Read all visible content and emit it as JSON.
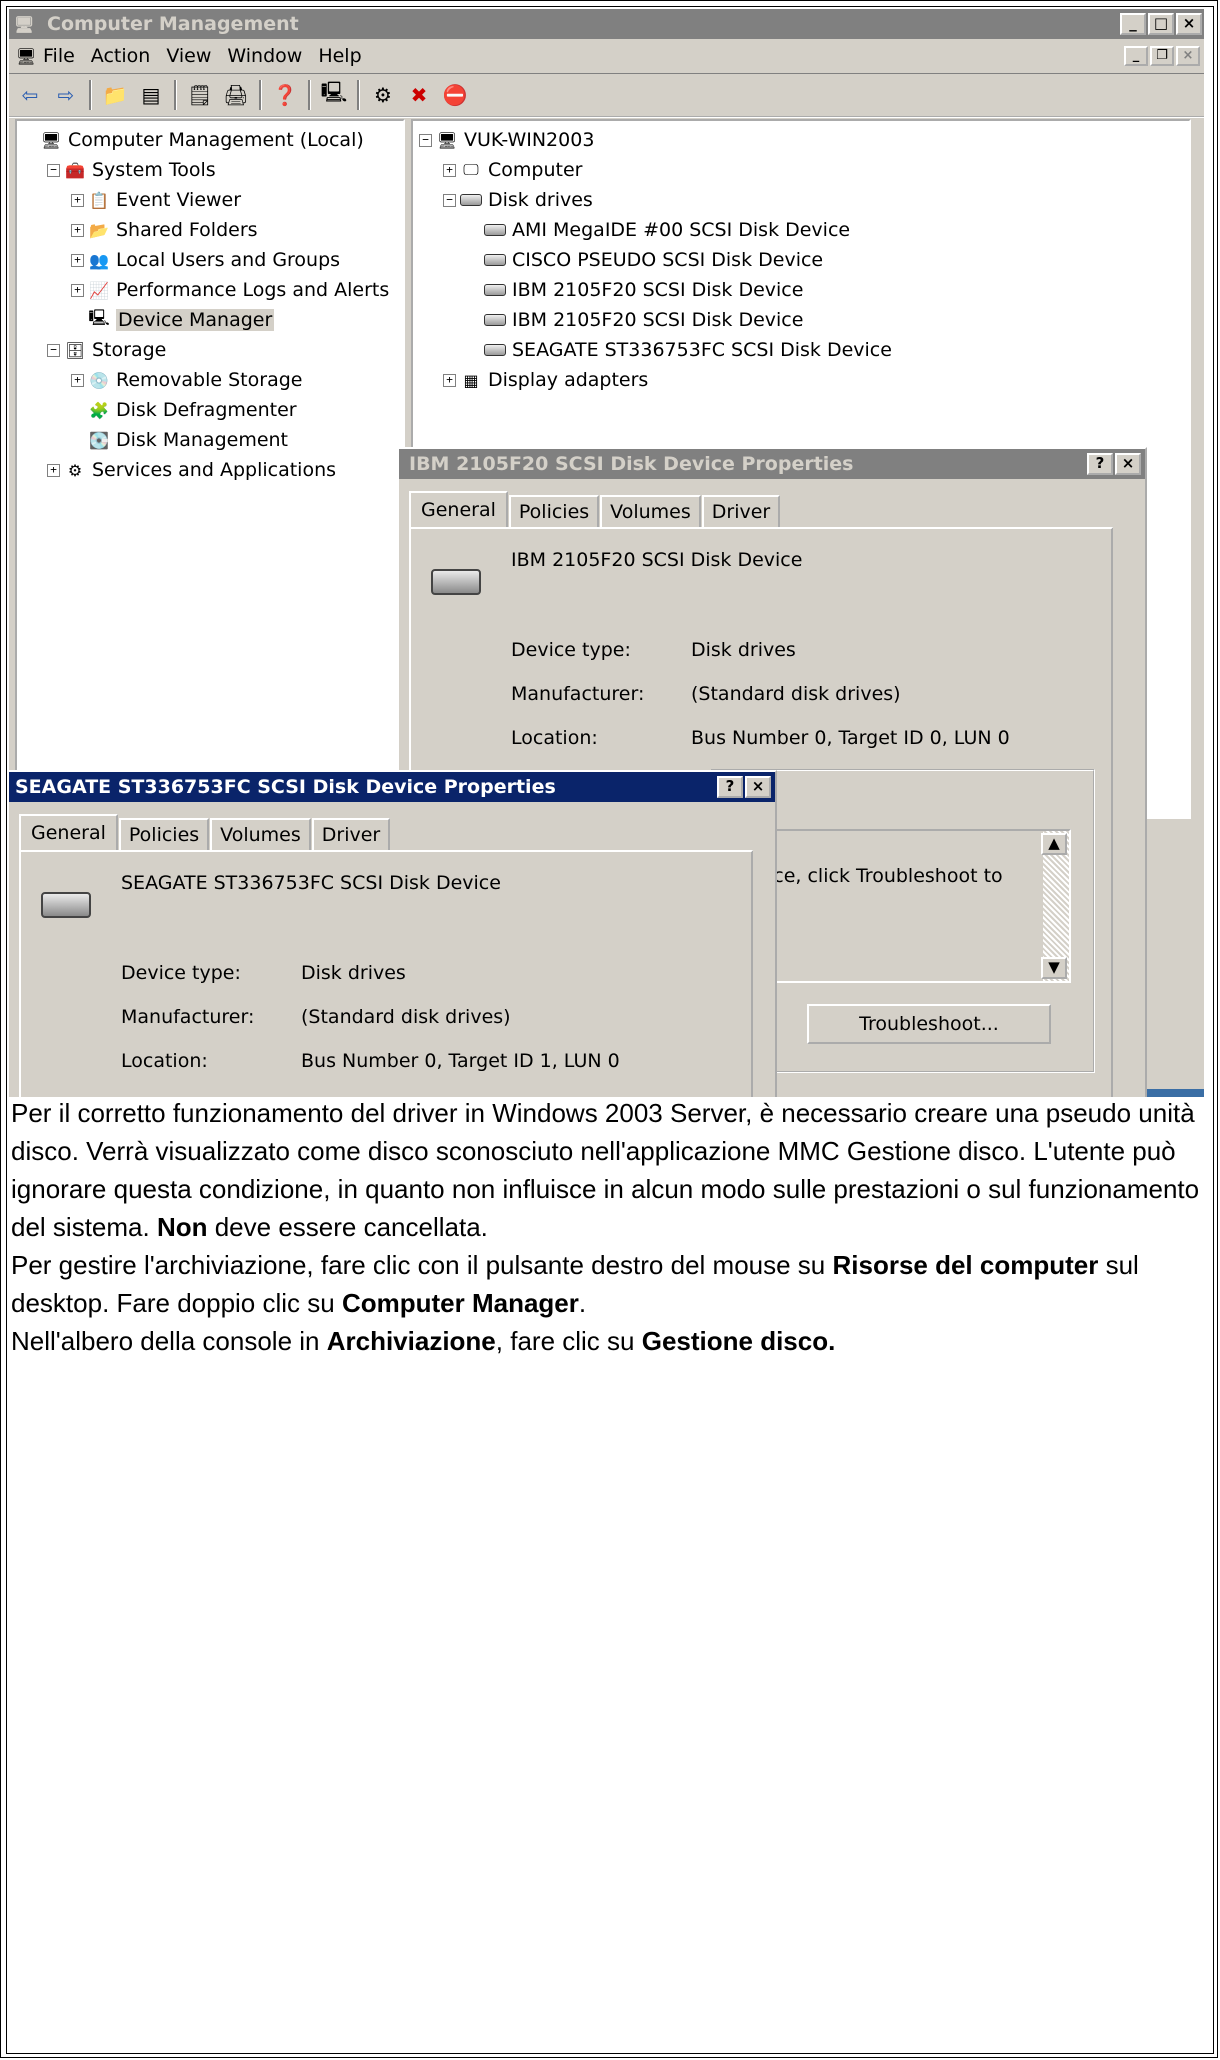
{
  "mmc": {
    "title": "Computer Management",
    "menu": [
      "File",
      "Action",
      "View",
      "Window",
      "Help"
    ],
    "menu_underline": [
      "F",
      "A",
      "V",
      "W",
      "H"
    ],
    "left_tree": [
      {
        "label": "Computer Management (Local)",
        "level": 0,
        "expander": "",
        "icon": "computer-management-icon"
      },
      {
        "label": "System Tools",
        "level": 1,
        "expander": "−",
        "icon": "system-tools-icon"
      },
      {
        "label": "Event Viewer",
        "level": 2,
        "expander": "+",
        "icon": "event-viewer-icon"
      },
      {
        "label": "Shared Folders",
        "level": 2,
        "expander": "+",
        "icon": "shared-folders-icon"
      },
      {
        "label": "Local Users and Groups",
        "level": 2,
        "expander": "+",
        "icon": "users-icon"
      },
      {
        "label": "Performance Logs and Alerts",
        "level": 2,
        "expander": "+",
        "icon": "performance-icon"
      },
      {
        "label": "Device Manager",
        "level": 2,
        "expander": "",
        "icon": "device-manager-icon",
        "selected": true
      },
      {
        "label": "Storage",
        "level": 1,
        "expander": "−",
        "icon": "storage-icon"
      },
      {
        "label": "Removable Storage",
        "level": 2,
        "expander": "+",
        "icon": "removable-storage-icon"
      },
      {
        "label": "Disk Defragmenter",
        "level": 2,
        "expander": "",
        "icon": "defragmenter-icon"
      },
      {
        "label": "Disk Management",
        "level": 2,
        "expander": "",
        "icon": "disk-management-icon"
      },
      {
        "label": "Services and Applications",
        "level": 1,
        "expander": "+",
        "icon": "services-icon"
      }
    ],
    "right_tree": [
      {
        "label": "VUK-WIN2003",
        "level": 0,
        "expander": "−",
        "icon": "computer-icon"
      },
      {
        "label": "Computer",
        "level": 1,
        "expander": "+",
        "icon": "monitor-icon"
      },
      {
        "label": "Disk drives",
        "level": 1,
        "expander": "−",
        "icon": "disk-icon"
      },
      {
        "label": "AMI MegaIDE #00 SCSI Disk Device",
        "level": 2,
        "expander": "",
        "icon": "disk-icon"
      },
      {
        "label": "CISCO PSEUDO SCSI Disk Device",
        "level": 2,
        "expander": "",
        "icon": "disk-icon"
      },
      {
        "label": "IBM 2105F20 SCSI Disk Device",
        "level": 2,
        "expander": "",
        "icon": "disk-icon"
      },
      {
        "label": "IBM 2105F20 SCSI Disk Device",
        "level": 2,
        "expander": "",
        "icon": "disk-icon"
      },
      {
        "label": "SEAGATE ST336753FC SCSI Disk Device",
        "level": 2,
        "expander": "",
        "icon": "disk-icon"
      },
      {
        "label": "Display adapters",
        "level": 1,
        "expander": "+",
        "icon": "display-adapter-icon"
      }
    ]
  },
  "dialog_ibm": {
    "title": "IBM 2105F20 SCSI Disk Device Properties",
    "tabs": [
      "General",
      "Policies",
      "Volumes",
      "Driver"
    ],
    "device_name": "IBM 2105F20 SCSI Disk Device",
    "device_type_label": "Device type:",
    "device_type": "Disk drives",
    "manufacturer_label": "Manufacturer:",
    "manufacturer": "(Standard disk drives)",
    "location_label": "Location:",
    "location": "Bus Number 0, Target ID 0, LUN 0",
    "status_text": "device, click Troubleshoot to",
    "troubleshoot_label": "Troubleshoot..."
  },
  "dialog_seagate": {
    "title": "SEAGATE ST336753FC SCSI Disk Device Properties",
    "tabs": [
      "General",
      "Policies",
      "Volumes",
      "Driver"
    ],
    "device_name": "SEAGATE ST336753FC SCSI Disk Device",
    "device_type_label": "Device type:",
    "device_type": "Disk drives",
    "manufacturer_label": "Manufacturer:",
    "manufacturer": "(Standard disk drives)",
    "location_label": "Location:",
    "location": "Bus Number 0, Target ID 1, LUN 0"
  },
  "text": {
    "p1_a": "Per il corretto funzionamento del driver in Windows 2003 Server, è necessario creare una pseudo unità disco. Verrà visualizzato come disco sconosciuto nell'applicazione MMC Gestione disco. L'utente può ignorare questa condizione, in quanto non influisce in alcun modo sulle prestazioni o sul funzionamento del sistema. ",
    "p1_bold": "Non",
    "p1_b": " deve essere cancellata.",
    "p2_a": "Per gestire l'archiviazione, fare clic con il pulsante destro del mouse su ",
    "p2_bold1": "Risorse del computer",
    "p2_b": " sul desktop. Fare doppio clic su ",
    "p2_bold2": "Computer Manager",
    "p2_c": ".",
    "p3_a": "Nell'albero della console in ",
    "p3_bold1": "Archiviazione",
    "p3_b": ", fare clic su ",
    "p3_bold2": "Gestione disco."
  }
}
